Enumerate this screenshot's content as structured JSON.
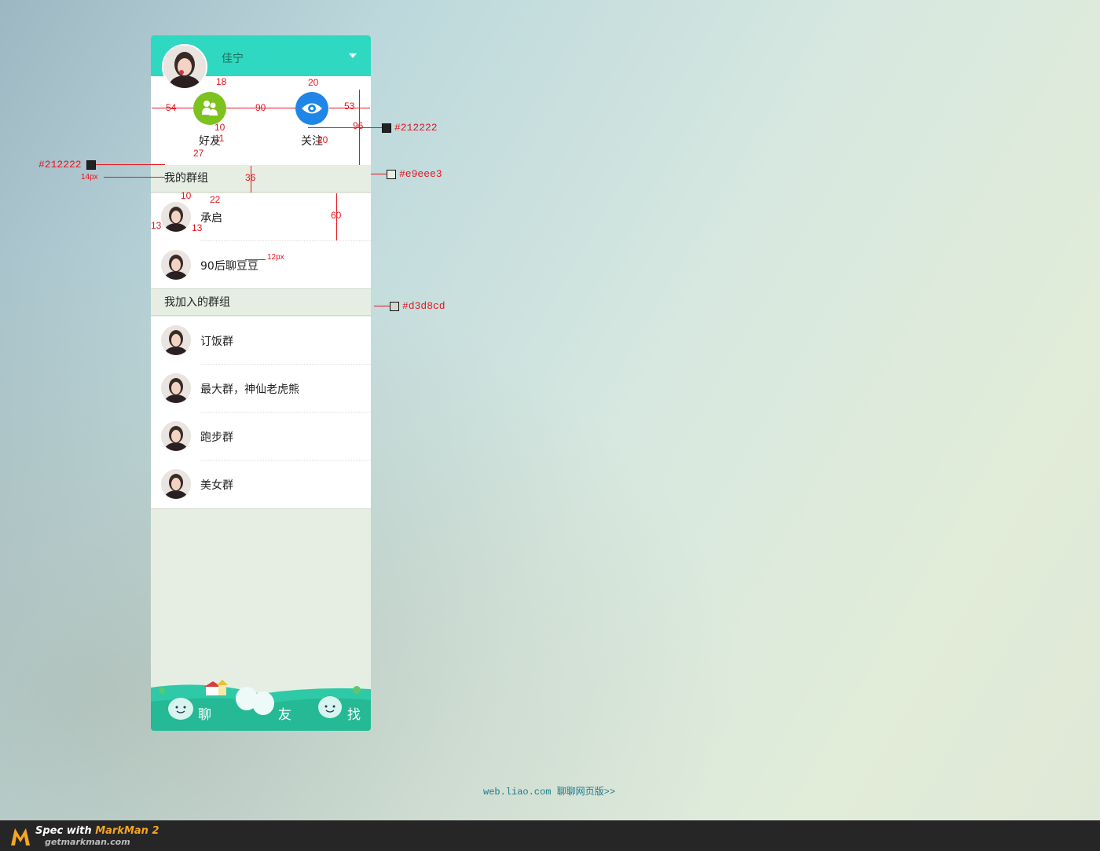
{
  "header": {
    "username": "佳宁"
  },
  "actions": {
    "friends_label": "好友",
    "follow_label": "关注"
  },
  "sections": [
    {
      "title": "我的群组",
      "items": [
        "承启",
        "90后聊豆豆"
      ]
    },
    {
      "title": "我加入的群组",
      "items": [
        "订饭群",
        "最大群，神仙老虎熊",
        "跑步群",
        "美女群"
      ]
    }
  ],
  "footer": {
    "tabs": [
      "聊",
      "友",
      "找"
    ]
  },
  "bottom_link": "web.liao.com 聊聊网页版>>",
  "annotations": {
    "dimensions": [
      "54",
      "90",
      "53",
      "18",
      "20",
      "10",
      "11",
      "20",
      "96",
      "27",
      "36",
      "10",
      "22",
      "13",
      "13",
      "60"
    ],
    "colors": [
      "#212222",
      "#212222",
      "#e9eee3",
      "#d3d8cd"
    ],
    "font_sizes": [
      "14px",
      "12px"
    ]
  },
  "markman": {
    "title_prefix": "Spec with ",
    "title_brand": "MarkMan 2",
    "url": "getmarkman.com"
  },
  "colors": {
    "header": "#2fd8c0",
    "friends": "#7dc21e",
    "follow": "#1f86e8",
    "section_bg": "#e6eee3",
    "divider": "#d3d8cd",
    "text": "#212222",
    "annotation": "#e8141d"
  }
}
